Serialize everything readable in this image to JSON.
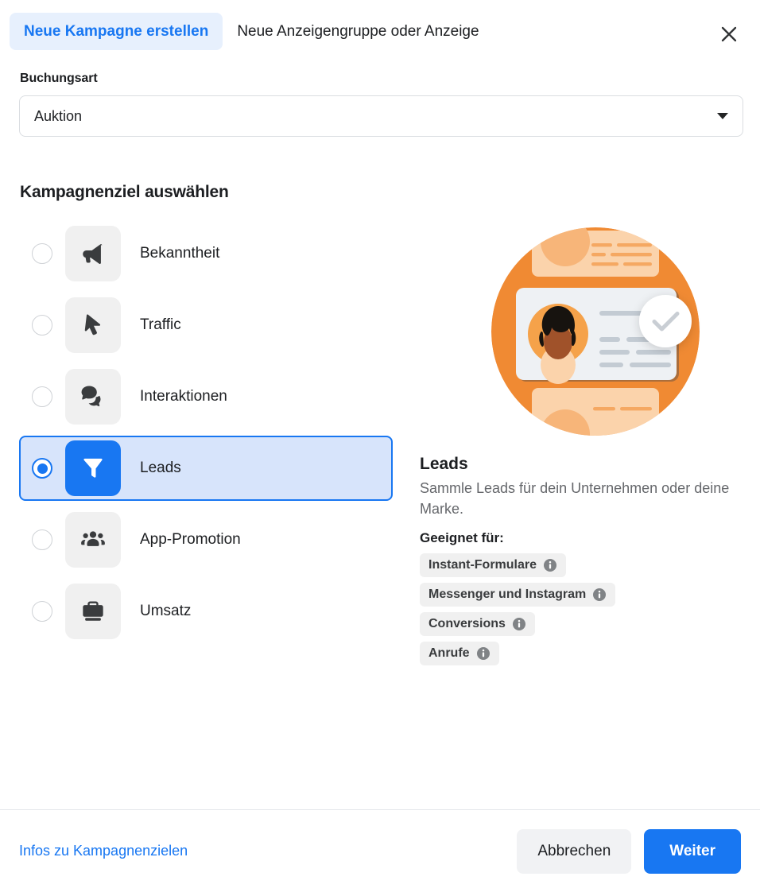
{
  "header": {
    "tab_active": "Neue Kampagne erstellen",
    "tab_inactive": "Neue Anzeigengruppe oder Anzeige",
    "close_icon": "close-icon"
  },
  "booking": {
    "label": "Buchungsart",
    "value": "Auktion",
    "caret_icon": "chevron-down-icon"
  },
  "objectives_section": {
    "title": "Kampagnenziel auswählen",
    "items": [
      {
        "label": "Bekanntheit",
        "icon": "megaphone-icon",
        "selected": false
      },
      {
        "label": "Traffic",
        "icon": "cursor-arrow-icon",
        "selected": false
      },
      {
        "label": "Interaktionen",
        "icon": "speech-bubbles-icon",
        "selected": false
      },
      {
        "label": "Leads",
        "icon": "funnel-icon",
        "selected": true
      },
      {
        "label": "App-Promotion",
        "icon": "people-group-icon",
        "selected": false
      },
      {
        "label": "Umsatz",
        "icon": "briefcase-icon",
        "selected": false
      }
    ]
  },
  "detail": {
    "illustration_name": "leads-illustration",
    "title": "Leads",
    "description": "Sammle Leads für dein Unternehmen oder deine Marke.",
    "suitable_label": "Geeignet für:",
    "pills": [
      {
        "label": "Instant-Formulare",
        "icon": "info-icon"
      },
      {
        "label": "Messenger und Instagram",
        "icon": "info-icon"
      },
      {
        "label": "Conversions",
        "icon": "info-icon"
      },
      {
        "label": "Anrufe",
        "icon": "info-icon"
      }
    ]
  },
  "footer": {
    "link": "Infos zu Kampagnenzielen",
    "cancel": "Abbrechen",
    "next": "Weiter"
  },
  "colors": {
    "accent_blue": "#1877f2",
    "selected_row_bg": "#d7e4fb",
    "active_tab_bg": "#e7f0fd",
    "icon_tile_bg": "#f0f0f0",
    "pill_bg": "#f0f0f0",
    "muted_text": "#65676b",
    "illustration_orange": "#f08a33"
  }
}
